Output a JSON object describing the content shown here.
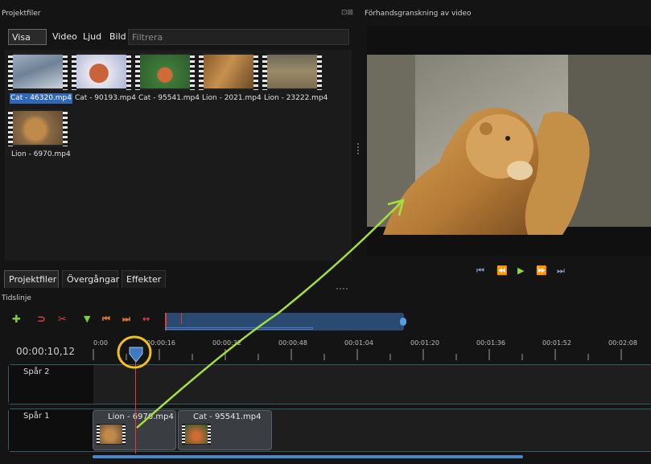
{
  "panels": {
    "project_files_title": "Projektfiler",
    "preview_title": "Förhandsgranskning av video",
    "timeline_title": "Tidslinje"
  },
  "filter": {
    "tabs": [
      "Visa allt",
      "Video",
      "Ljud",
      "Bild"
    ],
    "active_tab": "Visa allt",
    "placeholder": "Filtrera",
    "value": ""
  },
  "files": [
    {
      "name": "Cat - 46320.mp4",
      "selected": true
    },
    {
      "name": "Cat - 90193.mp4",
      "selected": false
    },
    {
      "name": "Cat - 95541.mp4",
      "selected": false
    },
    {
      "name": "Lion - 2021.mp4",
      "selected": false
    },
    {
      "name": "Lion - 23222.mp4",
      "selected": false
    },
    {
      "name": "Lion - 6970.mp4",
      "selected": false
    }
  ],
  "bottom_tabs": [
    "Projektfiler",
    "Övergångar",
    "Effekter"
  ],
  "playback": {
    "buttons": [
      "jump-start",
      "rewind",
      "play",
      "fast-forward",
      "jump-end"
    ],
    "icons": {
      "jump-start": "⏮",
      "rewind": "⏪",
      "play": "▶",
      "fast-forward": "⏩",
      "jump-end": "⏭"
    }
  },
  "timeline": {
    "current_time": "00:00:10,12",
    "ruler_labels": [
      "0:00",
      "00:00:16",
      "00:00:32",
      "00:00:48",
      "00:01:04",
      "00:01:20",
      "00:01:36",
      "00:01:52",
      "00:02:08"
    ],
    "toolbar_icons": {
      "add": "✚",
      "snap": "⊃",
      "razor": "✂",
      "marker": "▼",
      "prev_marker": "⏮",
      "next_marker": "⏭",
      "center": "↔"
    },
    "tracks": [
      {
        "name": "Spår 2",
        "clips": []
      },
      {
        "name": "Spår 1",
        "clips": [
          "Lion - 6970.mp4",
          "Cat - 95541.mp4"
        ]
      }
    ]
  },
  "colors": {
    "accent": "#2f68b8",
    "playhead": "#e23a3a",
    "annotation_arrow": "#a6e03a",
    "annotation_circle": "#f0c020",
    "track_border": "#3a5a62"
  }
}
